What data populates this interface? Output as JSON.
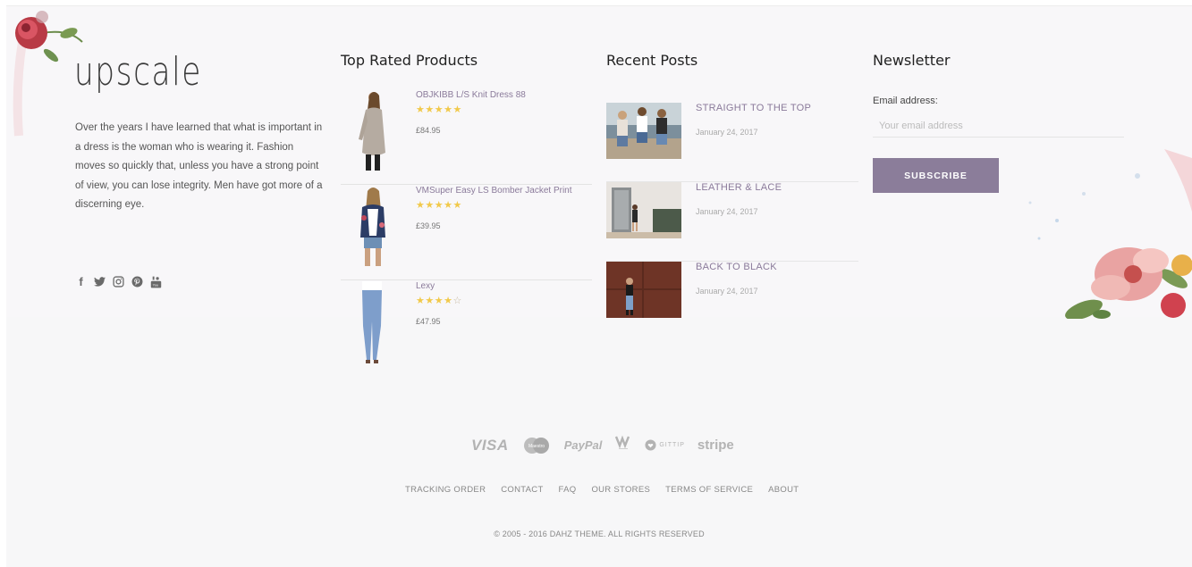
{
  "brand": {
    "logo_text": "upscale"
  },
  "about": {
    "text": "Over the years I have learned that what is important in a dress is the woman who is wearing it. Fashion moves so quickly that, unless you have a strong point of view, you can lose integrity. Men have got more of a discerning eye."
  },
  "social": {
    "icons": [
      "facebook-icon",
      "twitter-icon",
      "instagram-icon",
      "pinterest-icon",
      "youtube-icon"
    ],
    "glyphs": [
      "f",
      "🐦",
      "◎",
      "ⓟ",
      "▣"
    ]
  },
  "top_rated": {
    "title": "Top Rated Products",
    "products": [
      {
        "name": "OBJKIBB L/S Knit Dress 88",
        "rating": 5,
        "stars": "★★★★★",
        "stars_empty": "",
        "price": "£84.95"
      },
      {
        "name": "VMSuper Easy LS Bomber Jacket Print",
        "rating": 5,
        "stars": "★★★★★",
        "stars_empty": "",
        "price": "£39.95"
      },
      {
        "name": "Lexy",
        "rating": 4,
        "stars": "★★★★",
        "stars_empty": "☆",
        "price": "£47.95"
      }
    ]
  },
  "recent_posts": {
    "title": "Recent Posts",
    "posts": [
      {
        "title": "STRAIGHT TO THE TOP",
        "date": "January 24, 2017"
      },
      {
        "title": "LEATHER & LACE",
        "date": "January 24, 2017"
      },
      {
        "title": "BACK TO BLACK",
        "date": "January 24, 2017"
      }
    ]
  },
  "newsletter": {
    "title": "Newsletter",
    "email_label": "Email address:",
    "email_placeholder": "Your email address",
    "subscribe_label": "SUBSCRIBE"
  },
  "payments": {
    "visa": "VISA",
    "maestro": "Maestro",
    "paypal": "PayPal",
    "gittip": "GITTIP",
    "stripe": "stripe"
  },
  "footer_links": [
    "TRACKING ORDER",
    "CONTACT",
    "FAQ",
    "OUR STORES",
    "TERMS OF SERVICE",
    "ABOUT"
  ],
  "copyright": "© 2005 - 2016 DAHZ THEME. ALL RIGHTS RESERVED",
  "colors": {
    "accent": "#8b7d9a",
    "star": "#f1c94a",
    "background": "#f8f7f9"
  }
}
